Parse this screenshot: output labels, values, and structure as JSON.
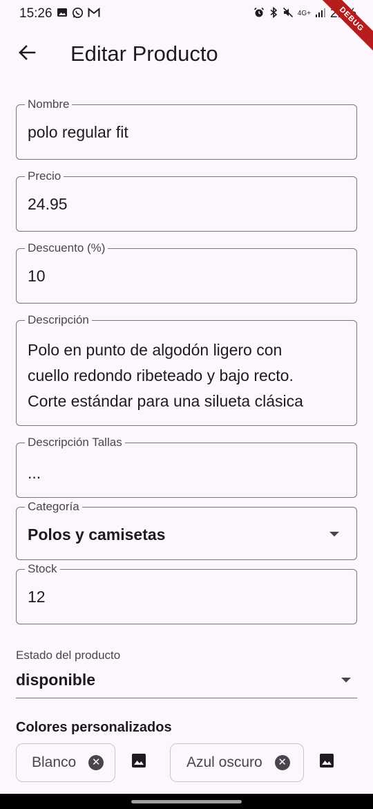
{
  "status_bar": {
    "time": "15:26",
    "network": "4G+",
    "battery": "21%",
    "left_icons": [
      "image-icon",
      "whatsapp-icon",
      "gmail-icon"
    ],
    "right_icons": [
      "alarm-icon",
      "bluetooth-icon",
      "mute-icon",
      "signal-icon",
      "battery-icon"
    ]
  },
  "debug_banner": "DEBUG",
  "app_bar": {
    "title": "Editar Producto",
    "back_icon": "arrow-back-icon"
  },
  "form": {
    "nombre": {
      "label": "Nombre",
      "value": "polo regular fit"
    },
    "precio": {
      "label": "Precio",
      "value": "24.95"
    },
    "descuento": {
      "label": "Descuento (%)",
      "value": "10"
    },
    "descripcion": {
      "label": "Descripción",
      "line1": "Polo en punto de algodón ligero con",
      "line2": "cuello redondo ribeteado y bajo recto.",
      "line3": "Corte estándar para una silueta clásica"
    },
    "descripcion_tallas": {
      "label": "Descripción Tallas",
      "value": "..."
    },
    "categoria": {
      "label": "Categoría",
      "value": "Polos y camisetas"
    },
    "stock": {
      "label": "Stock",
      "value": "12"
    },
    "estado": {
      "label": "Estado del producto",
      "value": "disponible"
    }
  },
  "colors": {
    "heading": "Colores personalizados",
    "chips": [
      {
        "label": "Blanco"
      },
      {
        "label": "Azul oscuro"
      }
    ],
    "delete_glyph": "✕",
    "image_icon": "image-icon"
  },
  "theme": {
    "background": "#fdf7fd",
    "outline": "#79747e",
    "text": "#1d1b20",
    "label": "#49454f",
    "debug": "#b71c1c"
  }
}
